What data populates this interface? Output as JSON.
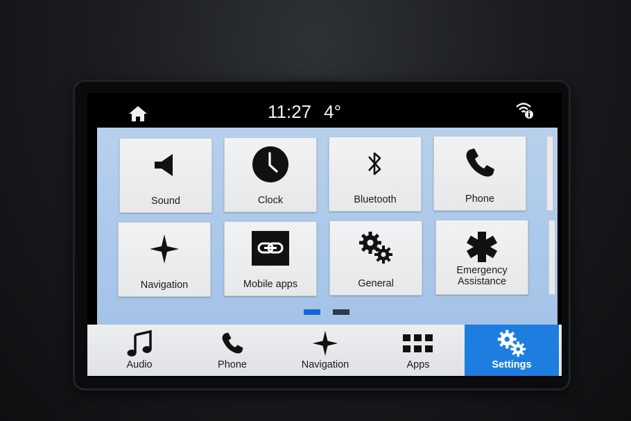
{
  "status": {
    "time": "11:27",
    "temperature": "4°"
  },
  "tiles": [
    {
      "label": "Sound",
      "icon": "speaker-icon"
    },
    {
      "label": "Clock",
      "icon": "clock-icon"
    },
    {
      "label": "Bluetooth",
      "icon": "bluetooth-icon"
    },
    {
      "label": "Phone",
      "icon": "phone-icon"
    },
    {
      "label": "Navigation",
      "icon": "navigation-star-icon"
    },
    {
      "label": "Mobile apps",
      "icon": "mobile-apps-link-icon"
    },
    {
      "label": "General",
      "icon": "gears-icon"
    },
    {
      "label": "Emergency Assistance",
      "label_line1": "Emergency",
      "label_line2": "Assistance",
      "icon": "asterisk-icon"
    }
  ],
  "pager": {
    "pages": 2,
    "current": 1
  },
  "bottom_nav": [
    {
      "label": "Audio",
      "icon": "music-note-icon"
    },
    {
      "label": "Phone",
      "icon": "phone-icon"
    },
    {
      "label": "Navigation",
      "icon": "navigation-star-icon"
    },
    {
      "label": "Apps",
      "icon": "apps-grid-icon"
    },
    {
      "label": "Settings",
      "icon": "gears-icon",
      "active": true
    }
  ],
  "colors": {
    "accent": "#1e7ee0",
    "content_bg": "#aac8ea",
    "tile_bg": "#eceef0",
    "pager_active": "#1565d8",
    "pager_inactive": "#2a3a4a"
  }
}
